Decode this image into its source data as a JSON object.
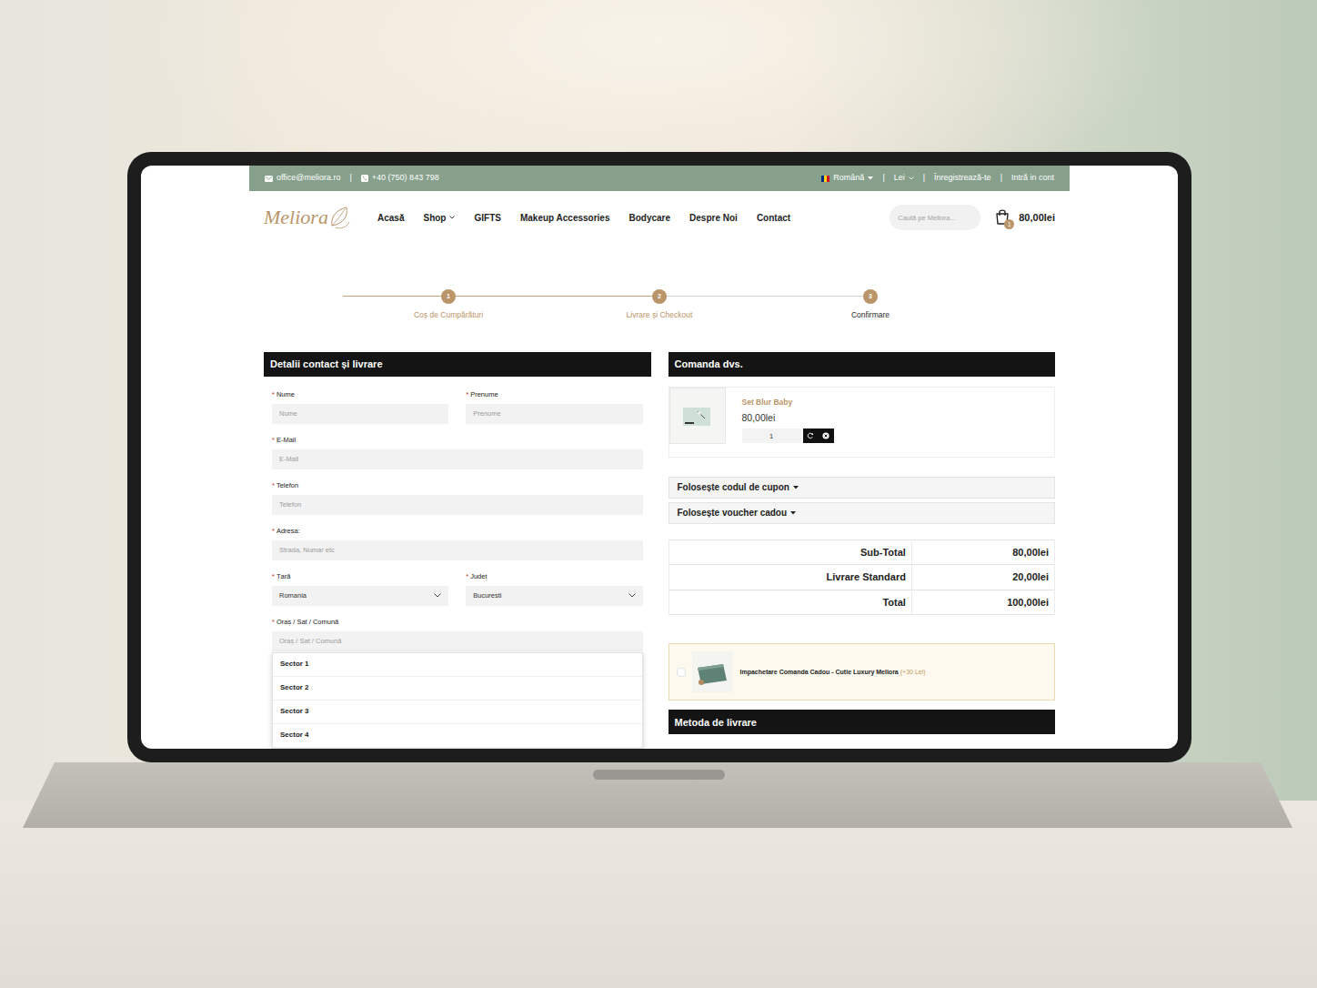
{
  "topbar": {
    "email": "office@meliora.ro",
    "phone": "+40 (750) 843 798",
    "language": "Română",
    "currency": "Lei",
    "register": "Înregistrează-te",
    "login": "Intră in cont",
    "separator": "|"
  },
  "logo": "Meliora",
  "nav": [
    {
      "label": "Acasă",
      "dropdown": false
    },
    {
      "label": "Shop",
      "dropdown": true
    },
    {
      "label": "GIFTS",
      "dropdown": false
    },
    {
      "label": "Makeup Accessories",
      "dropdown": false
    },
    {
      "label": "Bodycare",
      "dropdown": false
    },
    {
      "label": "Despre Noi",
      "dropdown": false
    },
    {
      "label": "Contact",
      "dropdown": false
    }
  ],
  "search": {
    "placeholder": "Caută pe Meliora..."
  },
  "cart": {
    "count": "1",
    "total": "80,00lei"
  },
  "steps": [
    {
      "number": "1",
      "label": "Coș de Cumpărături",
      "completed": true
    },
    {
      "number": "2",
      "label": "Livrare și Checkout",
      "completed": true
    },
    {
      "number": "3",
      "label": "Confirmare",
      "completed": false
    }
  ],
  "form": {
    "title": "Detalii contact și livrare",
    "required_mark": "*",
    "rows": [
      [
        {
          "label": "Nume",
          "required": true,
          "kind": "input",
          "placeholder": "Nume"
        },
        {
          "label": "Prenume",
          "required": true,
          "kind": "input",
          "placeholder": "Prenume"
        }
      ],
      [
        {
          "label": "E-Mail",
          "required": true,
          "kind": "input",
          "placeholder": "E-Mail"
        }
      ],
      [
        {
          "label": "Telefon",
          "required": true,
          "kind": "input",
          "placeholder": "Telefon"
        }
      ],
      [
        {
          "label": "Adresa:",
          "required": true,
          "kind": "input",
          "placeholder": "Strada, Numar etc"
        }
      ],
      [
        {
          "label": "Țară",
          "required": true,
          "kind": "select",
          "value": "Romania"
        },
        {
          "label": "Județ",
          "required": true,
          "kind": "select",
          "value": "Bucuresti"
        }
      ],
      [
        {
          "label": "Oraș / Sat / Comună",
          "required": true,
          "kind": "combo",
          "placeholder": "Oraș / Sat / Comună",
          "expanded": true,
          "options": [
            "Sector 1",
            "Sector 2",
            "Sector 3",
            "Sector 4"
          ]
        }
      ]
    ]
  },
  "order": {
    "title": "Comanda dvs.",
    "items": [
      {
        "name": "Set Blur Baby",
        "price": "80,00lei",
        "quantity": "1"
      }
    ],
    "toggles": [
      {
        "label": "Folosește codul de cupon",
        "expanded": false
      },
      {
        "label": "Folosește voucher cadou",
        "expanded": false
      }
    ],
    "totals": [
      {
        "label": "Sub-Total",
        "value": "80,00lei"
      },
      {
        "label": "Livrare Standard",
        "value": "20,00lei"
      },
      {
        "label": "Total",
        "value": "100,00lei"
      }
    ],
    "gift": {
      "label": "Impachetare Comanda Cadou - Cutie Luxury Meliora",
      "extra": "(+30 Lei)",
      "checked": false
    }
  },
  "shipping": {
    "title": "Metoda de livrare"
  }
}
